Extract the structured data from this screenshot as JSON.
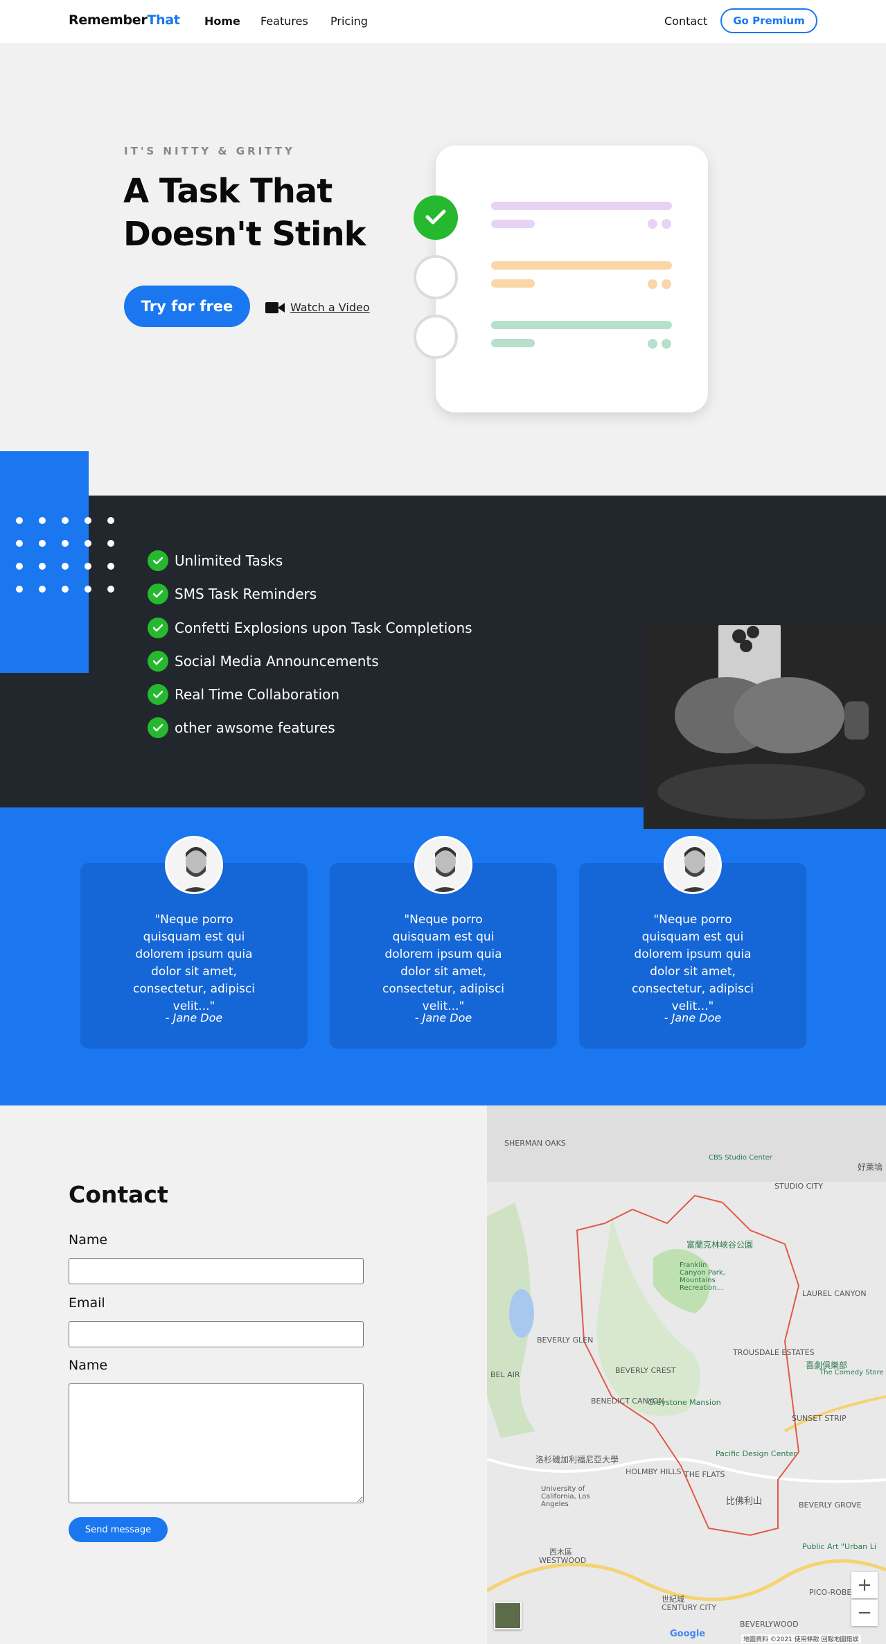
{
  "nav": {
    "brand_part1": "Remember",
    "brand_part2": "That",
    "links": [
      "Home",
      "Features",
      "Pricing"
    ],
    "contact": "Contact",
    "premium": "Go Premium"
  },
  "hero": {
    "eyebrow": "IT'S NITTY & GRITTY",
    "title": "A Task That Doesn't Stink",
    "cta": "Try for free",
    "video": "Watch a Video"
  },
  "colors": {
    "accent": "#1a77f0",
    "dark": "#22272d",
    "success": "#26b82f",
    "task_purple": "#e6d3f5",
    "task_orange": "#fad6a8",
    "task_green": "#b7e0cc"
  },
  "features": [
    "Unlimited Tasks",
    "SMS Task Reminders",
    "Confetti Explosions upon Task Completions",
    "Social Media Announcements",
    "Real Time Collaboration",
    "other awsome features"
  ],
  "testimonials": [
    {
      "quote": "\"Neque porro quisquam est qui dolorem ipsum quia dolor sit amet, consectetur, adipisci velit...\"",
      "author": "- Jane Doe"
    },
    {
      "quote": "\"Neque porro quisquam est qui dolorem ipsum quia dolor sit amet, consectetur, adipisci velit...\"",
      "author": "- Jane Doe"
    },
    {
      "quote": "\"Neque porro quisquam est qui dolorem ipsum quia dolor sit amet, consectetur, adipisci velit...\"",
      "author": "- Jane Doe"
    }
  ],
  "contact": {
    "title": "Contact",
    "name_label": "Name",
    "email_label": "Email",
    "message_label": "Name",
    "send": "Send message"
  },
  "map": {
    "labels": [
      "SHERMAN OAKS",
      "STUDIO CITY",
      "LAUREL CANYON",
      "BEVERLY GLEN",
      "BEVERLY CREST",
      "TROUSDALE ESTATES",
      "BENEDICT CANYON",
      "Greystone Mansion",
      "Pacific Design Center",
      "HOLMBY HILLS",
      "THE FLATS",
      "BEVERLY GROVE",
      "WESTWOOD",
      "CENTURY CITY",
      "BEVERLYWOOD",
      "SUNSET STRIP",
      "BEL AIR",
      "Franklin Canyon Park, Mountains Recreation...",
      "University of California, Los Angeles",
      "The Comedy Store",
      "Public Art \"Urban Li",
      "PICO-ROBERTSON",
      "CBS Studio Center"
    ],
    "cn_labels": [
      "富蘭克林峽谷公園",
      "比佛利山",
      "洛杉磯加利福尼亞大學",
      "西木區",
      "喜劇俱樂部",
      "好萊塢",
      "世紀城"
    ],
    "zoom_in": "+",
    "zoom_out": "−",
    "footer": "地圖資料 ©2021   使用條款   回報地圖錯誤",
    "google": "Google"
  }
}
